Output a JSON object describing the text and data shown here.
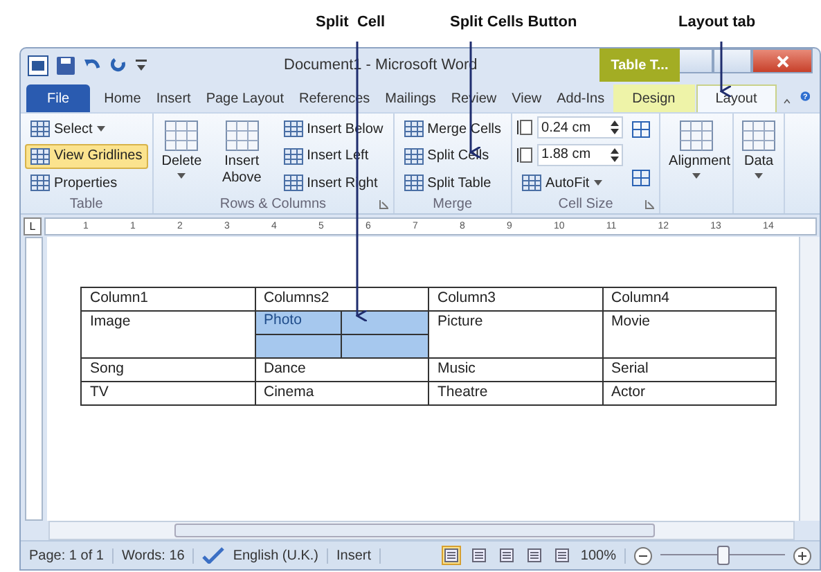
{
  "annotations": [
    {
      "text": "Split  Cell"
    },
    {
      "text": "Split Cells Button"
    },
    {
      "text": "Layout tab"
    }
  ],
  "window": {
    "title": "Document1 - Microsoft Word",
    "contextual_tab": "Table T..."
  },
  "help": "?",
  "tabs": [
    {
      "label": "File",
      "kind": "file",
      "selected": false
    },
    {
      "label": "Home",
      "kind": "tab",
      "selected": false
    },
    {
      "label": "Insert",
      "kind": "tab",
      "selected": false
    },
    {
      "label": "Page Layout",
      "kind": "tab",
      "selected": false
    },
    {
      "label": "References",
      "kind": "tab",
      "selected": false
    },
    {
      "label": "Mailings",
      "kind": "tab",
      "selected": false
    },
    {
      "label": "Review",
      "kind": "tab",
      "selected": false
    },
    {
      "label": "View",
      "kind": "tab",
      "selected": false
    },
    {
      "label": "Add-Ins",
      "kind": "tab",
      "selected": false
    },
    {
      "label": "Design",
      "kind": "context",
      "selected": false
    },
    {
      "label": "Layout",
      "kind": "context",
      "selected": true
    }
  ],
  "ribbon": [
    {
      "name": "Table",
      "columns": [
        [
          {
            "kind": "small",
            "label": "Select",
            "dropdown": true,
            "on": false
          },
          {
            "kind": "small",
            "label": "View Gridlines",
            "on": true
          },
          {
            "kind": "small",
            "label": "Properties",
            "on": false
          }
        ]
      ]
    },
    {
      "name": "Rows & Columns",
      "launcher": true,
      "columns": [
        [
          {
            "kind": "large",
            "label": "Delete",
            "dropdown": true,
            "on": false
          }
        ],
        [
          {
            "kind": "large",
            "label": "Insert Above",
            "on": false
          }
        ],
        [
          {
            "kind": "small",
            "label": "Insert Below",
            "on": false
          },
          {
            "kind": "small",
            "label": "Insert Left",
            "on": false
          },
          {
            "kind": "small",
            "label": "Insert Right",
            "on": false
          }
        ]
      ]
    },
    {
      "name": "Merge",
      "columns": [
        [
          {
            "kind": "small",
            "label": "Merge Cells",
            "on": false
          },
          {
            "kind": "small",
            "label": "Split Cells",
            "on": false
          },
          {
            "kind": "small",
            "label": "Split Table",
            "on": false
          }
        ]
      ]
    },
    {
      "name": "Cell Size",
      "launcher": true,
      "columns": [
        [
          {
            "kind": "spin",
            "label": "0.24 cm",
            "on": false
          },
          {
            "kind": "spin",
            "label": "1.88 cm",
            "on": false
          },
          {
            "kind": "small",
            "label": "AutoFit",
            "dropdown": true,
            "on": false
          }
        ],
        [
          {
            "kind": "icon",
            "on": false
          },
          {
            "kind": "icon",
            "on": false
          }
        ]
      ]
    },
    {
      "columns": [
        [
          {
            "kind": "large",
            "label": "Alignment",
            "dropdown": true,
            "on": false
          }
        ]
      ]
    },
    {
      "columns": [
        [
          {
            "kind": "large",
            "label": "Data",
            "dropdown": true,
            "on": false
          }
        ]
      ]
    }
  ],
  "tab_selector": "L",
  "ruler": [
    "1",
    "1",
    "2",
    "3",
    "4",
    "5",
    "6",
    "7",
    "8",
    "9",
    "10",
    "11",
    "12",
    "13",
    "14"
  ],
  "table": {
    "rows": [
      [
        {
          "text": "Column1",
          "split": false
        },
        {
          "text": "Columns2",
          "split": false
        },
        {
          "text": "Column3",
          "split": false
        },
        {
          "text": "Column4",
          "split": false
        }
      ],
      [
        {
          "text": "Image",
          "split": false
        },
        {
          "text": "Photo",
          "split": true
        },
        {
          "text": "Picture",
          "split": false
        },
        {
          "text": "Movie",
          "split": false
        }
      ],
      [
        {
          "text": "Song",
          "split": false
        },
        {
          "text": "Dance",
          "split": false
        },
        {
          "text": "Music",
          "split": false
        },
        {
          "text": "Serial",
          "split": false
        }
      ],
      [
        {
          "text": "TV",
          "split": false
        },
        {
          "text": "Cinema",
          "split": false
        },
        {
          "text": "Theatre",
          "split": false
        },
        {
          "text": "Actor",
          "split": false
        }
      ]
    ]
  },
  "status_bar": {
    "items": [
      "Page: 1 of 1",
      "Words: 16",
      "English (U.K.)",
      "Insert"
    ],
    "views": [
      {
        "selected": true
      },
      {
        "selected": false
      },
      {
        "selected": false
      },
      {
        "selected": false
      },
      {
        "selected": false
      }
    ],
    "zoom": {
      "text": "100%",
      "level": 0.5
    }
  }
}
